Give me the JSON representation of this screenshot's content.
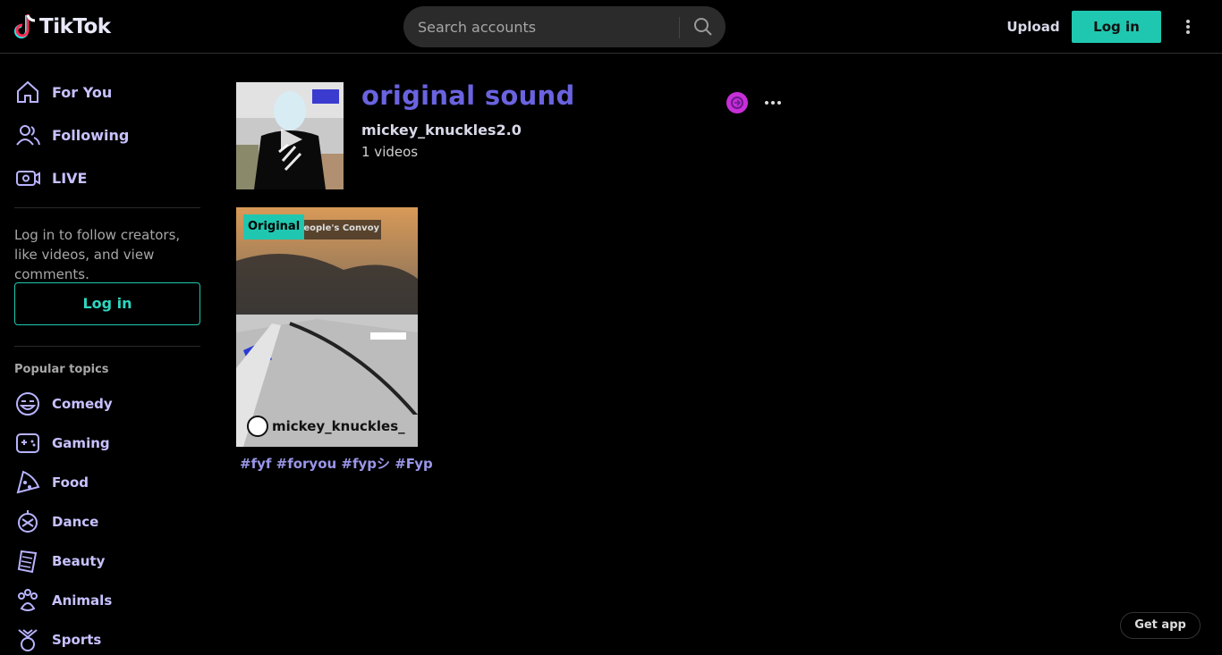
{
  "header": {
    "logo_text": "TikTok",
    "search_placeholder": "Search accounts",
    "upload_label": "Upload",
    "login_label": "Log in"
  },
  "sidebar": {
    "nav": [
      {
        "label": "For You",
        "icon": "home-icon"
      },
      {
        "label": "Following",
        "icon": "following-icon"
      },
      {
        "label": "LIVE",
        "icon": "live-icon"
      }
    ],
    "note": "Log in to follow creators, like videos, and view comments.",
    "login_label": "Log in",
    "popular_title": "Popular topics",
    "topics": [
      {
        "label": "Comedy",
        "icon": "comedy-icon"
      },
      {
        "label": "Gaming",
        "icon": "gaming-icon"
      },
      {
        "label": "Food",
        "icon": "food-icon"
      },
      {
        "label": "Dance",
        "icon": "dance-icon"
      },
      {
        "label": "Beauty",
        "icon": "beauty-icon"
      },
      {
        "label": "Animals",
        "icon": "animals-icon"
      },
      {
        "label": "Sports",
        "icon": "sports-icon"
      }
    ]
  },
  "sound": {
    "title": "original sound",
    "author": "mickey_knuckles2.0",
    "video_count": "1 videos"
  },
  "videos": [
    {
      "badge": "Original",
      "author": "mickey_knuckles_",
      "caption": "#fyf #foryou #fypシ #Fyp",
      "overlay_text": "People's Convoy"
    }
  ],
  "footer": {
    "get_app_label": "Get app"
  },
  "colors": {
    "accent": "#20c7b0",
    "title": "#6a63e0",
    "nav_text": "#c7c2ff"
  }
}
